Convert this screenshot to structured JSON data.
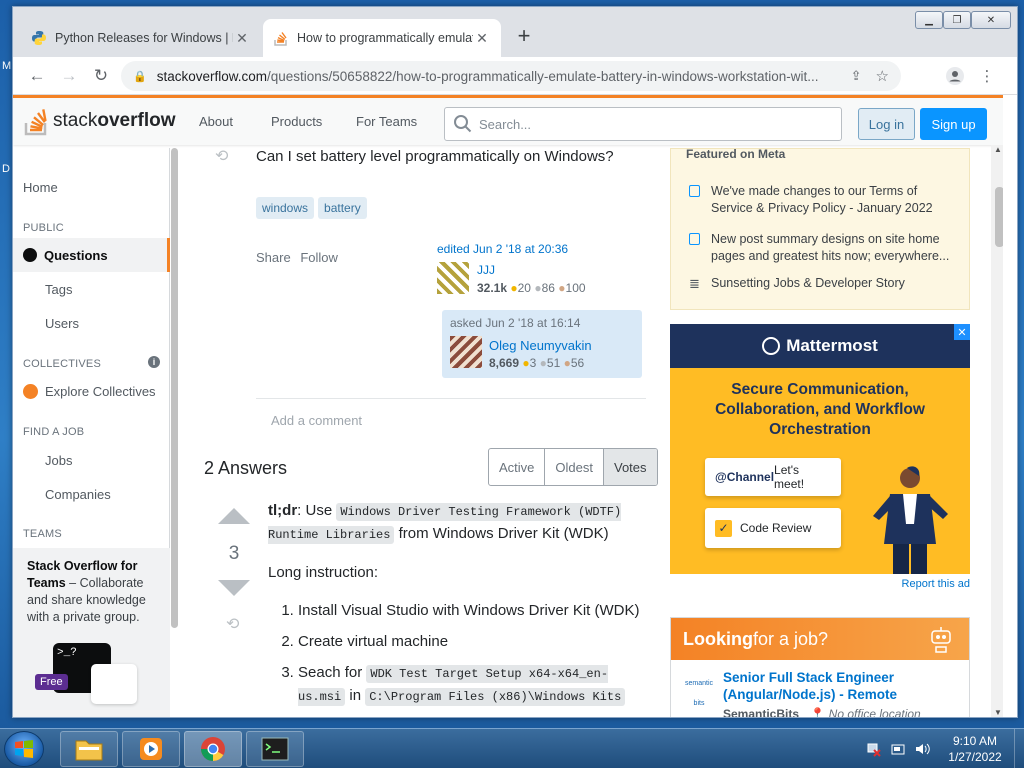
{
  "browser": {
    "tabs": [
      {
        "title": "Python Releases for Windows | P"
      },
      {
        "title": "How to programmatically emulat"
      }
    ],
    "url_host": "stackoverflow.com",
    "url_path": "/questions/50658822/how-to-programmatically-emulate-battery-in-windows-workstation-wit..."
  },
  "so_header": {
    "logo_text": "stack",
    "logo_bold": "overflow",
    "nav": [
      "About",
      "Products",
      "For Teams"
    ],
    "search_placeholder": "Search...",
    "login": "Log in",
    "signup": "Sign up"
  },
  "sidebar": {
    "home": "Home",
    "public": "PUBLIC",
    "questions": "Questions",
    "tags": "Tags",
    "users": "Users",
    "collectives": "COLLECTIVES",
    "explore": "Explore Collectives",
    "find_job": "FIND A JOB",
    "jobs": "Jobs",
    "companies": "Companies",
    "teams": "TEAMS",
    "teams_title": "Stack Overflow for Teams",
    "teams_dash": " – Collaborate and share knowledge with a private group.",
    "free": "Free"
  },
  "question": {
    "text": "Can I set battery level programmatically on Windows?",
    "tags": [
      "windows",
      "battery"
    ],
    "share": "Share",
    "follow": "Follow",
    "edited": "edited Jun 2 '18 at 20:36",
    "editor_name": "JJJ",
    "editor_rep": "32.1k",
    "editor_gold": "20",
    "editor_silver": "86",
    "editor_bronze": "100",
    "asked": "asked Jun 2 '18 at 16:14",
    "asker_name": "Oleg Neumyvakin",
    "asker_rep": "8,669",
    "asker_gold": "3",
    "asker_silver": "51",
    "asker_bronze": "56",
    "add_comment": "Add a comment"
  },
  "answers": {
    "count_label": "2 Answers",
    "sort": [
      "Active",
      "Oldest",
      "Votes"
    ],
    "vote_count": "3",
    "tldr_bold": "tl;dr",
    "tldr_use": ": Use ",
    "tldr_code": "Windows Driver Testing Framework (WDTF) Runtime Libraries",
    "tldr_rest": " from Windows Driver Kit (WDK)",
    "long": "Long instruction:",
    "steps": [
      "Install Visual Studio with Windows Driver Kit (WDK)",
      "Create virtual machine",
      "Seach for "
    ],
    "step3_code1": "WDK Test Target Setup x64-x64_en-us.msi",
    "step3_in": " in ",
    "step3_code2": "C:\\Program Files (x86)\\Windows Kits"
  },
  "meta": {
    "title": "Featured on Meta",
    "items": [
      "We've made changes to our Terms of Service & Privacy Policy - January 2022",
      "New post summary designs on site home pages and greatest hits now; everywhere...",
      "Sunsetting Jobs & Developer Story"
    ]
  },
  "ad": {
    "brand": "Mattermost",
    "headline": "Secure Communication, Collaboration, and Workflow Orchestration",
    "card1_mention": "@Channel",
    "card1_text": " Let's meet!",
    "card2": "Code Review",
    "report": "Report this ad"
  },
  "jobs": {
    "looking": "Looking",
    "for_job": " for a job?",
    "job_title": "Senior Full Stack Engineer (Angular/Node.js)",
    "remote": " - Remote",
    "company": "SemanticBits",
    "location": "No office location"
  },
  "taskbar": {
    "time": "9:10 AM",
    "date": "1/27/2022"
  },
  "colors": {
    "so_orange": "#f48225",
    "so_blue": "#0a95ff",
    "link": "#0074cc"
  }
}
